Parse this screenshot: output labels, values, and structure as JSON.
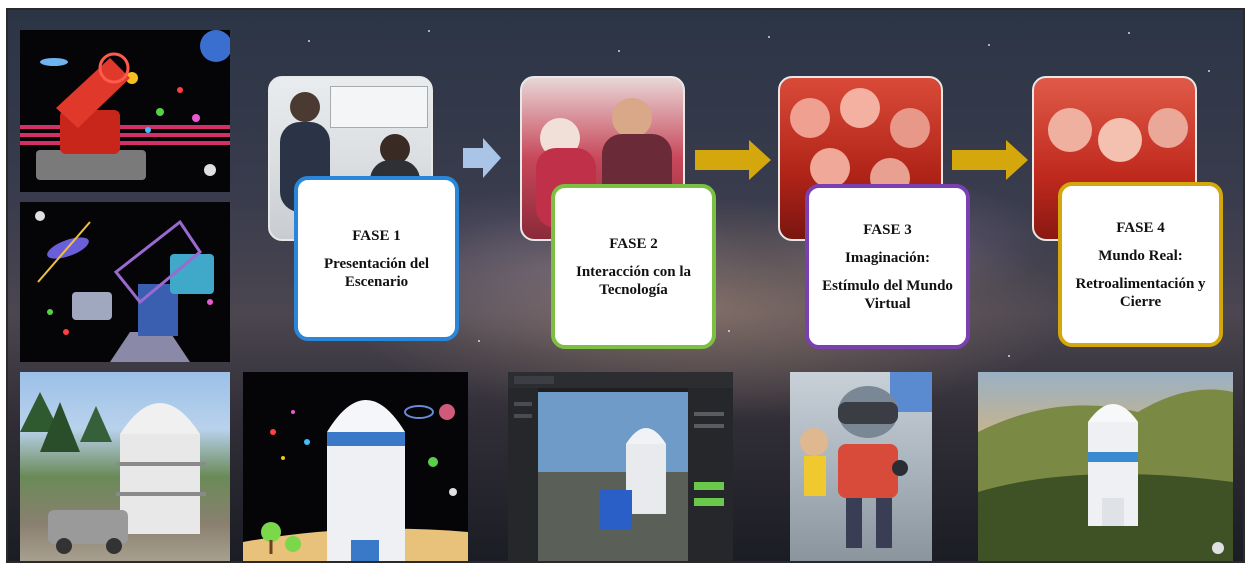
{
  "phases": [
    {
      "title": "FASE 1",
      "line1": "Presentación del Escenario",
      "line2": ""
    },
    {
      "title": "FASE 2",
      "line1": "Interacción con la Tecnología",
      "line2": ""
    },
    {
      "title": "FASE 3",
      "line1": "Imaginación:",
      "line2": "Estímulo del Mundo Virtual"
    },
    {
      "title": "FASE 4",
      "line1": "Mundo Real:",
      "line2": "Retroalimentación y Cierre"
    }
  ],
  "colors": {
    "fase1_border": "#2a86d8",
    "fase2_border": "#7bc043",
    "fase3_border": "#7a3fb0",
    "fase4_border": "#d4a80c",
    "arrow_first": "#a9c4e6",
    "arrow_gold": "#d4a80c"
  },
  "icons": [
    "telescope-render",
    "telescope-dome",
    "observatory-photo",
    "vr-editor-screenshot",
    "child-with-vr-headset",
    "aerial-observatory"
  ]
}
